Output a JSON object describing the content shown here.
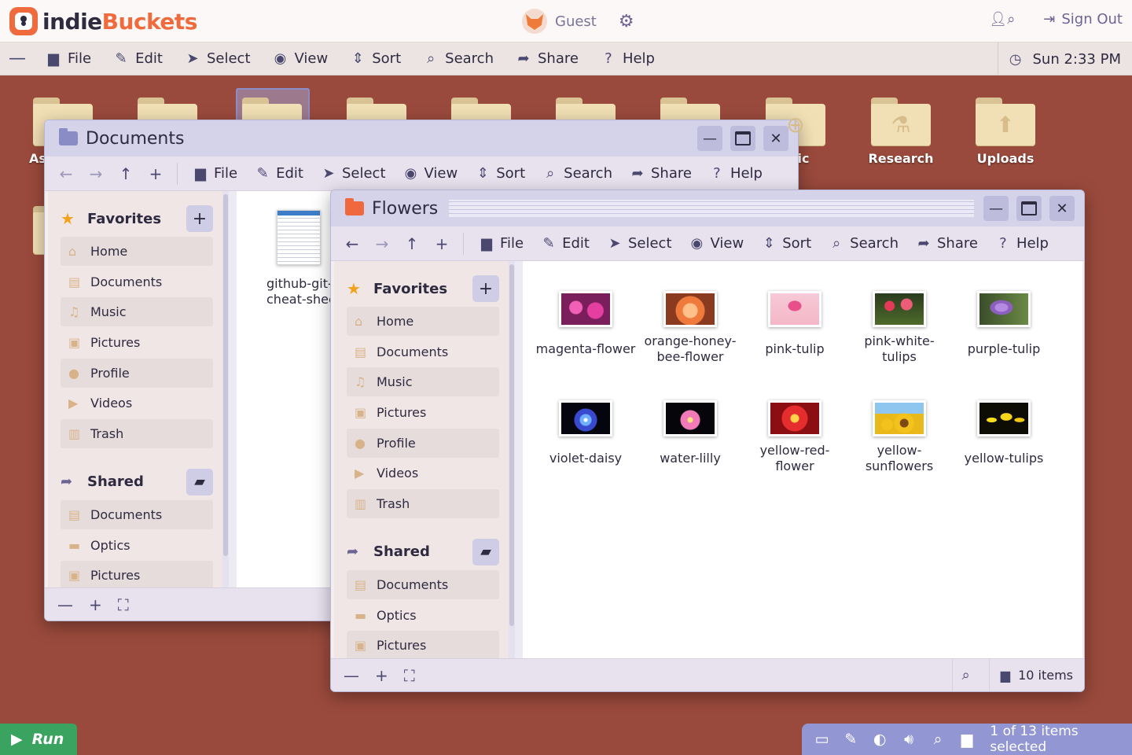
{
  "app": {
    "logo_part1": "indie",
    "logo_part2": "Buckets",
    "user": "Guest",
    "signout_label": "Sign Out"
  },
  "menubar": {
    "items": [
      {
        "label": "File",
        "icon": "file-icon"
      },
      {
        "label": "Edit",
        "icon": "pencil-icon"
      },
      {
        "label": "Select",
        "icon": "cursor-icon"
      },
      {
        "label": "View",
        "icon": "eye-icon"
      },
      {
        "label": "Sort",
        "icon": "sort-icon"
      },
      {
        "label": "Search",
        "icon": "search-icon"
      },
      {
        "label": "Share",
        "icon": "share-icon"
      },
      {
        "label": "Help",
        "icon": "help-icon"
      }
    ],
    "clock": "Sun 2:33 PM"
  },
  "desktop": {
    "folders": [
      {
        "label": "As"
      },
      {
        "label": ""
      },
      {
        "label": ""
      },
      {
        "label": ""
      },
      {
        "label": ""
      },
      {
        "label": ""
      },
      {
        "label": ""
      },
      {
        "label": "lic"
      },
      {
        "label": "Research"
      },
      {
        "label": "Uploads"
      }
    ]
  },
  "documents_window": {
    "title": "Documents",
    "sidebar": {
      "favorites_title": "Favorites",
      "favorites": [
        "Home",
        "Documents",
        "Music",
        "Pictures",
        "Profile",
        "Videos",
        "Trash"
      ],
      "shared_title": "Shared",
      "shared": [
        "Documents",
        "Optics",
        "Pictures"
      ]
    },
    "files": [
      {
        "name_line1": "github-git-",
        "name_line2": "cheat-shee"
      }
    ]
  },
  "flowers_window": {
    "title": "Flowers",
    "sidebar": {
      "favorites_title": "Favorites",
      "favorites": [
        "Home",
        "Documents",
        "Music",
        "Pictures",
        "Profile",
        "Videos",
        "Trash"
      ],
      "shared_title": "Shared",
      "shared": [
        "Documents",
        "Optics",
        "Pictures"
      ]
    },
    "files": [
      {
        "line1": "magenta-flower",
        "line2": ""
      },
      {
        "line1": "orange-honey-",
        "line2": "bee-flower"
      },
      {
        "line1": "pink-tulip",
        "line2": ""
      },
      {
        "line1": "pink-white-",
        "line2": "tulips"
      },
      {
        "line1": "purple-tulip",
        "line2": ""
      },
      {
        "line1": "violet-daisy",
        "line2": ""
      },
      {
        "line1": "water-lilly",
        "line2": ""
      },
      {
        "line1": "yellow-red-",
        "line2": "flower"
      },
      {
        "line1": "yellow-",
        "line2": "sunflowers"
      },
      {
        "line1": "yellow-tulips",
        "line2": ""
      }
    ],
    "status": "10 items"
  },
  "taskbar": {
    "run_label": "Run",
    "status": "1 of 13 items selected"
  },
  "colors": {
    "accent": "#ef6b3e",
    "run_green": "#3aa35f",
    "tray": "#9296d2",
    "desktop": "#9a4a3c"
  }
}
